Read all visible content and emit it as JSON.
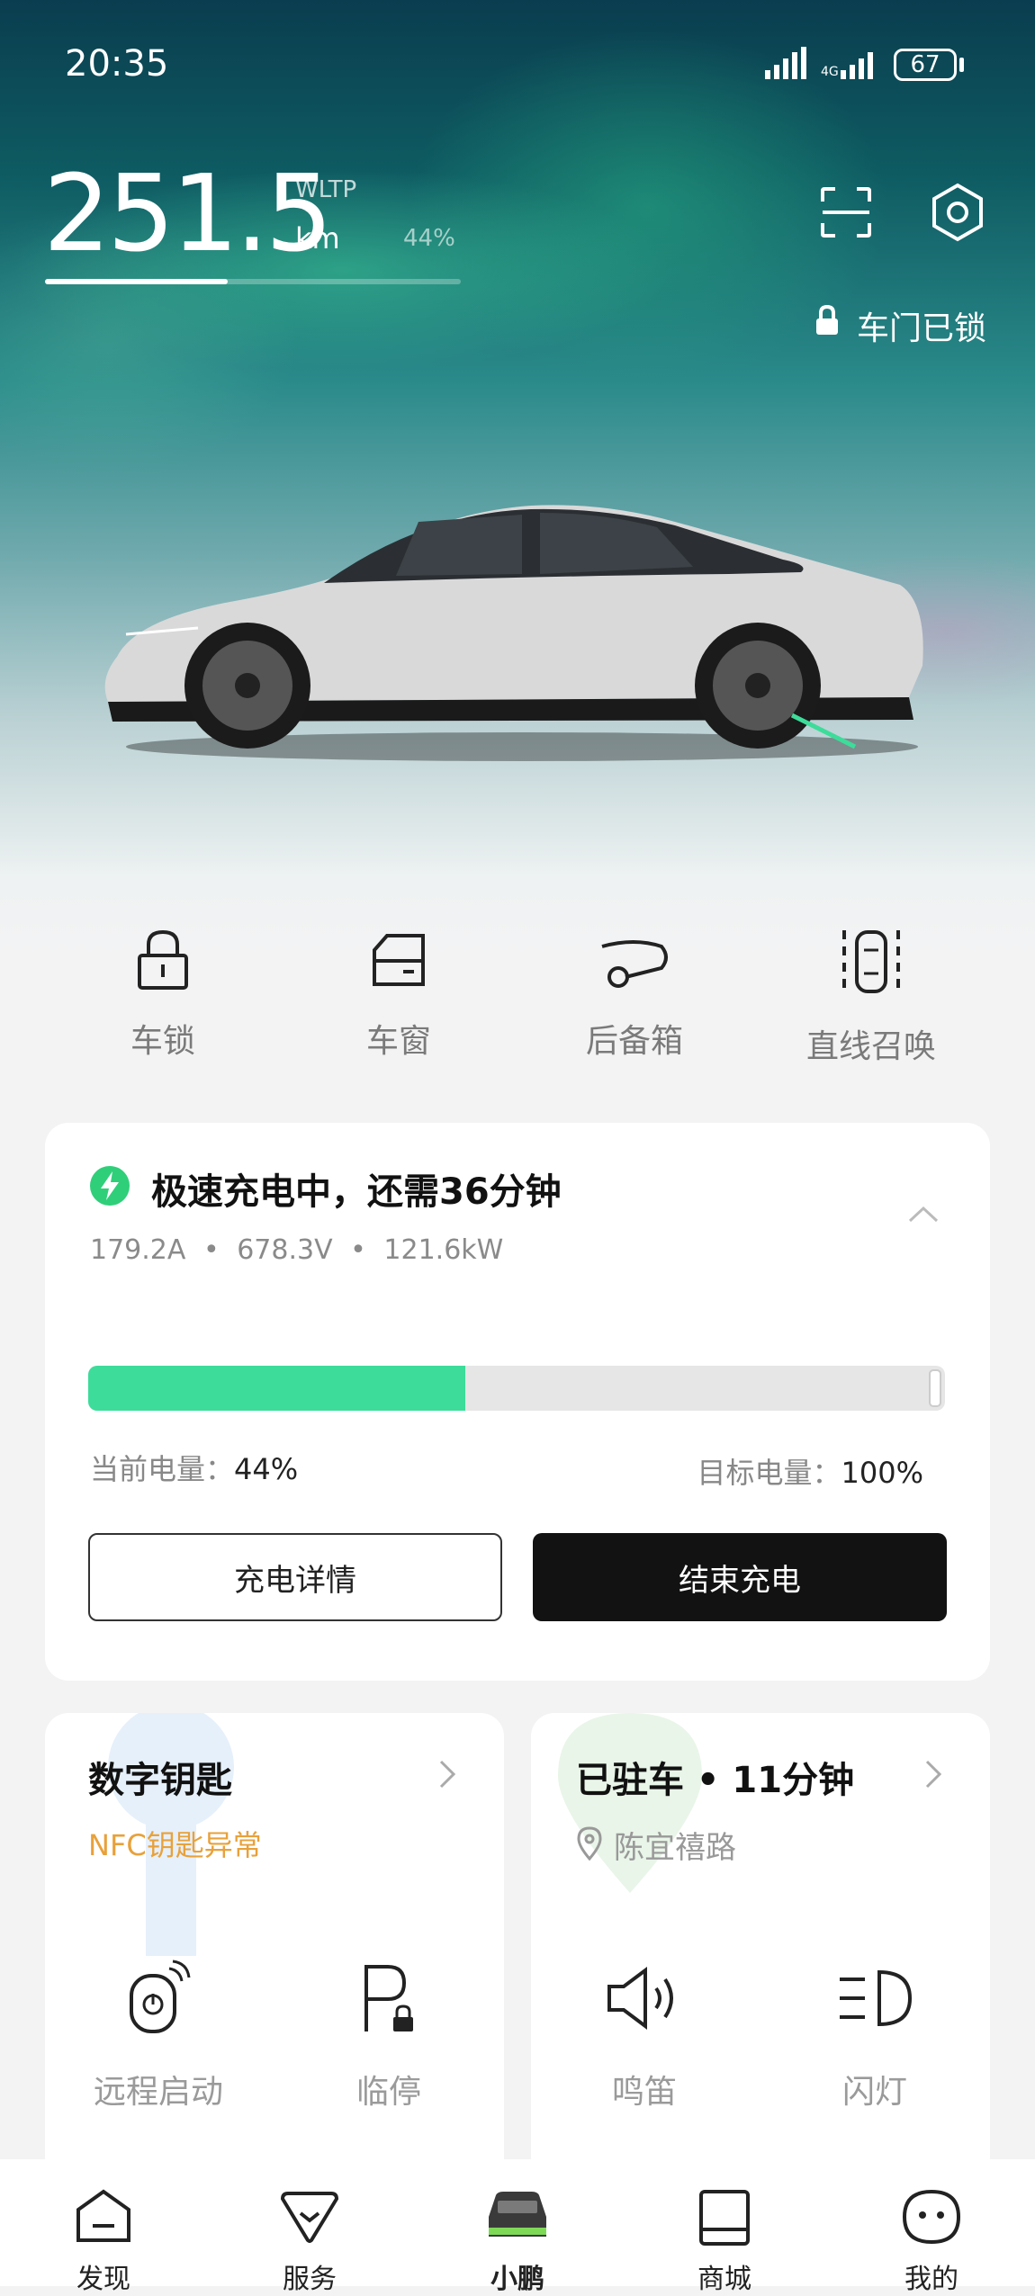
{
  "status_bar": {
    "time": "20:35",
    "battery": "67"
  },
  "range": {
    "value": "251.5",
    "standard": "WLTP",
    "unit": "km",
    "soc_label": "44%",
    "soc_fraction": 0.44
  },
  "door_status": "车门已锁",
  "quick_actions": [
    {
      "label": "车锁",
      "icon": "lock-icon"
    },
    {
      "label": "车窗",
      "icon": "window-icon"
    },
    {
      "label": "后备箱",
      "icon": "trunk-icon"
    },
    {
      "label": "直线召唤",
      "icon": "summon-icon"
    }
  ],
  "charging": {
    "title": "极速充电中，还需36分钟",
    "current": "179.2A",
    "voltage": "678.3V",
    "power": "121.6kW",
    "progress": 0.44,
    "current_soc_label": "当前电量：",
    "current_soc_value": "44%",
    "target_soc_label": "目标电量：",
    "target_soc_value": "100%",
    "details_button": "充电详情",
    "stop_button": "结束充电",
    "accent_color": "#3ddc9a"
  },
  "digital_key": {
    "title": "数字钥匙",
    "status": "NFC钥匙异常",
    "status_color": "#e8a13a"
  },
  "parking": {
    "title": "已驻车 • 11分钟",
    "location": "陈宜禧路"
  },
  "controls": [
    {
      "label": "远程启动",
      "icon": "remote-start-icon"
    },
    {
      "label": "临停",
      "icon": "temp-parking-icon"
    },
    {
      "label": "鸣笛",
      "icon": "horn-icon"
    },
    {
      "label": "闪灯",
      "icon": "headlight-icon"
    }
  ],
  "bottom_nav": [
    {
      "label": "发现"
    },
    {
      "label": "服务"
    },
    {
      "label": "小鹏",
      "active": true
    },
    {
      "label": "商城"
    },
    {
      "label": "我的"
    }
  ]
}
